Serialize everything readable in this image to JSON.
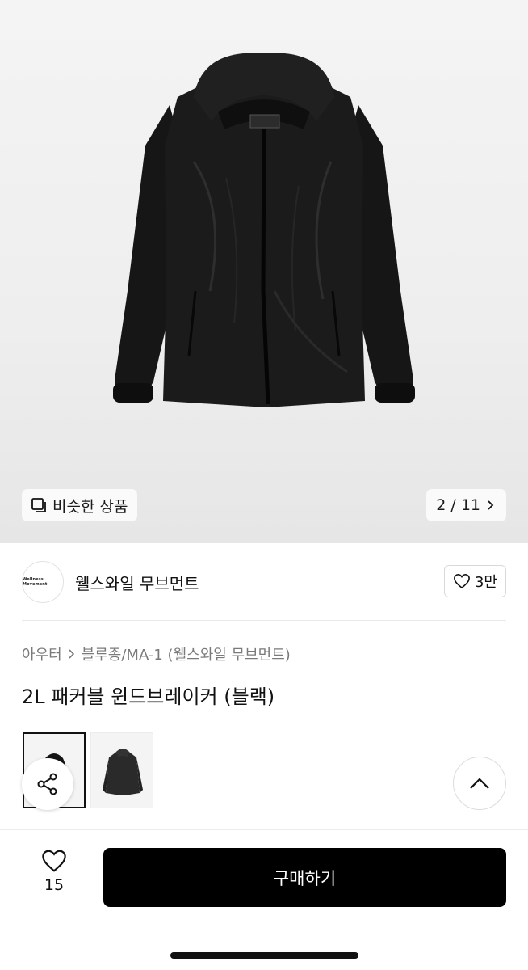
{
  "hero": {
    "similar_label": "비슷한 상품",
    "similar_icon": "similar-items-icon",
    "pager": "2 / 11",
    "pager_icon": "chevron-right-icon",
    "background": "#eeeeee"
  },
  "brand": {
    "logo_text": "Wellness Movement",
    "name": "웰스와일 무브먼트",
    "like_count": "3만",
    "like_icon": "heart-icon"
  },
  "breadcrumb": {
    "category": "아우터",
    "separator_icon": "chevron-right-icon",
    "subcategory": "블루종/MA-1 (웰스와일 무브먼트)"
  },
  "product": {
    "title": "2L 패커블 윈드브레이커 (블랙)",
    "color_options": [
      "black-full",
      "black-angle"
    ]
  },
  "floating": {
    "share_icon": "share-icon",
    "scroll_top_icon": "chevron-up-icon"
  },
  "bottom_bar": {
    "like_icon": "heart-icon",
    "like_count": "15",
    "buy_label": "구매하기",
    "buy_color": "#000000"
  }
}
